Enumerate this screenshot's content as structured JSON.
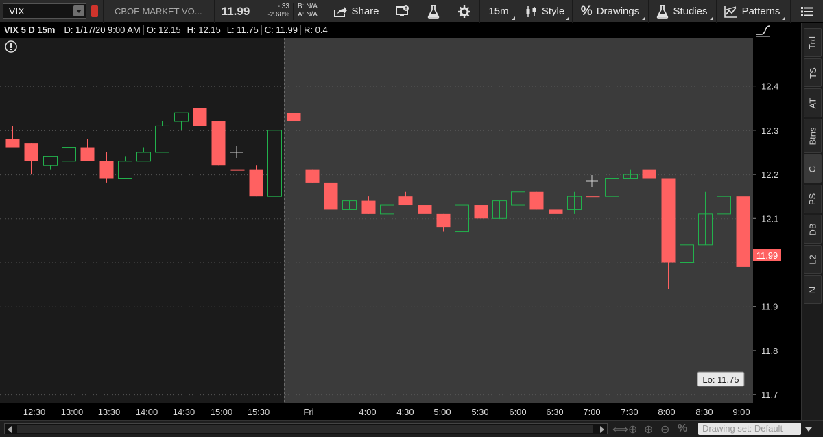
{
  "toolbar": {
    "symbol": "VIX",
    "description": "CBOE MARKET VO...",
    "last_price": "11.99",
    "change": "-.33",
    "change_pct": "-2.68%",
    "bid": "B: N/A",
    "ask": "A: N/A",
    "share_label": "Share",
    "timeframe_label": "15m",
    "style_label": "Style",
    "drawings_label": "Drawings",
    "studies_label": "Studies",
    "patterns_label": "Patterns"
  },
  "info_bar": {
    "symbol_period": "VIX 5 D 15m",
    "date": "D: 1/17/20 9:00 AM",
    "open": "O: 12.15",
    "high": "H: 12.15",
    "low": "L: 11.75",
    "close": "C: 11.99",
    "range": "R: 0.4"
  },
  "right_tabs": [
    "Trd",
    "TS",
    "AT",
    "Btns",
    "C",
    "PS",
    "DB",
    "L2",
    "N"
  ],
  "bottom_bar": {
    "drawing_set": "Drawing set: Default"
  },
  "colors": {
    "up": "#22b14c",
    "down": "#ff6161",
    "session_bg": "#1b1b1b",
    "extended_bg": "#3b3b3b"
  },
  "chart_data": {
    "type": "candlestick",
    "ylim": [
      11.68,
      12.51
    ],
    "y_ticks": [
      "12.4",
      "12.3",
      "12.2",
      "12.1",
      "11.9",
      "11.8",
      "11.7"
    ],
    "x_tick_labels": [
      "12:30",
      "13:00",
      "13:30",
      "14:00",
      "14:30",
      "15:00",
      "15:30",
      "Fri",
      "4:00",
      "4:30",
      "5:00",
      "5:30",
      "6:00",
      "6:30",
      "7:00",
      "7:30",
      "8:00",
      "8:30",
      "9:00"
    ],
    "price_label": "11.99",
    "low_label": "Lo: 11.75",
    "candles": [
      {
        "o": 12.28,
        "h": 12.31,
        "l": 12.26,
        "c": 12.26
      },
      {
        "o": 12.27,
        "h": 12.27,
        "l": 12.2,
        "c": 12.23
      },
      {
        "o": 12.22,
        "h": 12.24,
        "l": 12.21,
        "c": 12.24
      },
      {
        "o": 12.23,
        "h": 12.28,
        "l": 12.2,
        "c": 12.26
      },
      {
        "o": 12.26,
        "h": 12.28,
        "l": 12.23,
        "c": 12.23
      },
      {
        "o": 12.23,
        "h": 12.25,
        "l": 12.18,
        "c": 12.19
      },
      {
        "o": 12.19,
        "h": 12.24,
        "l": 12.19,
        "c": 12.23
      },
      {
        "o": 12.23,
        "h": 12.26,
        "l": 12.23,
        "c": 12.25
      },
      {
        "o": 12.25,
        "h": 12.32,
        "l": 12.25,
        "c": 12.31
      },
      {
        "o": 12.32,
        "h": 12.34,
        "l": 12.3,
        "c": 12.34
      },
      {
        "o": 12.35,
        "h": 12.36,
        "l": 12.3,
        "c": 12.31
      },
      {
        "o": 12.32,
        "h": 12.32,
        "l": 12.22,
        "c": 12.22
      },
      {
        "o": 12.21,
        "h": 12.21,
        "l": 12.21,
        "c": 12.21
      },
      {
        "o": 12.21,
        "h": 12.22,
        "l": 12.15,
        "c": 12.15
      },
      {
        "o": 12.15,
        "h": 12.3,
        "l": 12.15,
        "c": 12.3
      },
      {
        "o": 12.34,
        "h": 12.42,
        "l": 12.31,
        "c": 12.32
      },
      {
        "o": 12.21,
        "h": 12.21,
        "l": 12.18,
        "c": 12.18
      },
      {
        "o": 12.18,
        "h": 12.19,
        "l": 12.11,
        "c": 12.12
      },
      {
        "o": 12.12,
        "h": 12.14,
        "l": 12.12,
        "c": 12.14
      },
      {
        "o": 12.14,
        "h": 12.15,
        "l": 12.11,
        "c": 12.11
      },
      {
        "o": 12.11,
        "h": 12.13,
        "l": 12.11,
        "c": 12.13
      },
      {
        "o": 12.15,
        "h": 12.16,
        "l": 12.13,
        "c": 12.13
      },
      {
        "o": 12.13,
        "h": 12.14,
        "l": 12.09,
        "c": 12.11
      },
      {
        "o": 12.11,
        "h": 12.11,
        "l": 12.07,
        "c": 12.08
      },
      {
        "o": 12.07,
        "h": 12.13,
        "l": 12.06,
        "c": 12.13
      },
      {
        "o": 12.13,
        "h": 12.14,
        "l": 12.1,
        "c": 12.1
      },
      {
        "o": 12.1,
        "h": 12.14,
        "l": 12.1,
        "c": 12.14
      },
      {
        "o": 12.13,
        "h": 12.16,
        "l": 12.13,
        "c": 12.16
      },
      {
        "o": 12.16,
        "h": 12.16,
        "l": 12.12,
        "c": 12.12
      },
      {
        "o": 12.12,
        "h": 12.13,
        "l": 12.11,
        "c": 12.11
      },
      {
        "o": 12.12,
        "h": 12.16,
        "l": 12.11,
        "c": 12.15
      },
      {
        "o": 12.15,
        "h": 12.15,
        "l": 12.15,
        "c": 12.15
      },
      {
        "o": 12.15,
        "h": 12.19,
        "l": 12.15,
        "c": 12.19
      },
      {
        "o": 12.19,
        "h": 12.21,
        "l": 12.19,
        "c": 12.2
      },
      {
        "o": 12.21,
        "h": 12.21,
        "l": 12.19,
        "c": 12.19
      },
      {
        "o": 12.19,
        "h": 12.19,
        "l": 11.94,
        "c": 12.0
      },
      {
        "o": 12.0,
        "h": 12.04,
        "l": 11.99,
        "c": 12.04
      },
      {
        "o": 12.04,
        "h": 12.16,
        "l": 12.04,
        "c": 12.11
      },
      {
        "o": 12.11,
        "h": 12.17,
        "l": 12.08,
        "c": 12.15
      },
      {
        "o": 12.15,
        "h": 12.15,
        "l": 11.75,
        "c": 11.99
      }
    ]
  }
}
